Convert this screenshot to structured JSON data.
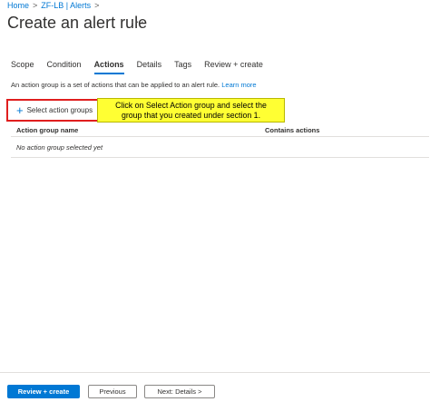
{
  "breadcrumb": {
    "items": [
      "Home",
      "ZF-LB | Alerts"
    ],
    "separator": ">"
  },
  "page": {
    "title": "Create an alert rule",
    "more": "···"
  },
  "tabs": [
    "Scope",
    "Condition",
    "Actions",
    "Details",
    "Tags",
    "Review + create"
  ],
  "active_tab": "Actions",
  "description": {
    "text": "An action group is a set of actions that can be applied to an alert rule.",
    "link": "Learn more"
  },
  "select_button": {
    "icon": "plus-icon",
    "label": "Select action groups"
  },
  "callout": {
    "line1": "Click on Select Action group and select the",
    "line2": "group that you created under section 1."
  },
  "table": {
    "columns": [
      "Action group name",
      "Contains actions"
    ],
    "empty_text": "No action group selected yet"
  },
  "footer": {
    "review_create": "Review + create",
    "previous": "Previous",
    "next": "Next: Details >"
  },
  "colors": {
    "accent": "#0078d4",
    "highlight_border": "#e01e1e",
    "callout_bg": "#ffff33"
  }
}
